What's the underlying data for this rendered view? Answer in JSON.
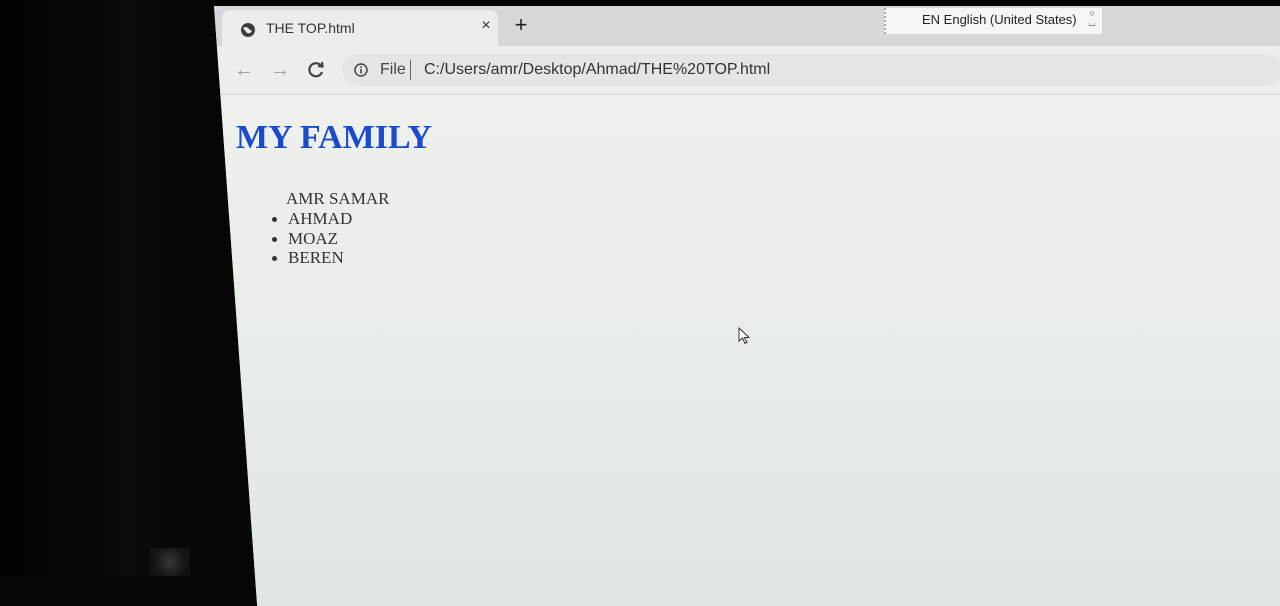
{
  "browser": {
    "tab": {
      "title": "THE TOP.html",
      "close": "×"
    },
    "new_tab": "+",
    "language_bar": {
      "text": "EN English (United States)"
    },
    "toolbar": {
      "back": "←",
      "forward": "→",
      "reload": "C",
      "scheme": "File",
      "url": "C:/Users/amr/Desktop/Ahmad/THE%20TOP.html"
    }
  },
  "page": {
    "heading": "MY FAMILY",
    "parent": "AMR SAMAR",
    "children": [
      "AHMAD",
      "MOAZ",
      "BEREN"
    ]
  },
  "colors": {
    "heading": "#1a4bcc",
    "tabbar": "#d6d7db",
    "page_bg": "#eef0ee"
  },
  "icons": [
    "globe-icon",
    "close-icon",
    "plus-icon",
    "back-arrow-icon",
    "forward-arrow-icon",
    "reload-icon",
    "info-icon",
    "mouse-cursor-icon"
  ]
}
